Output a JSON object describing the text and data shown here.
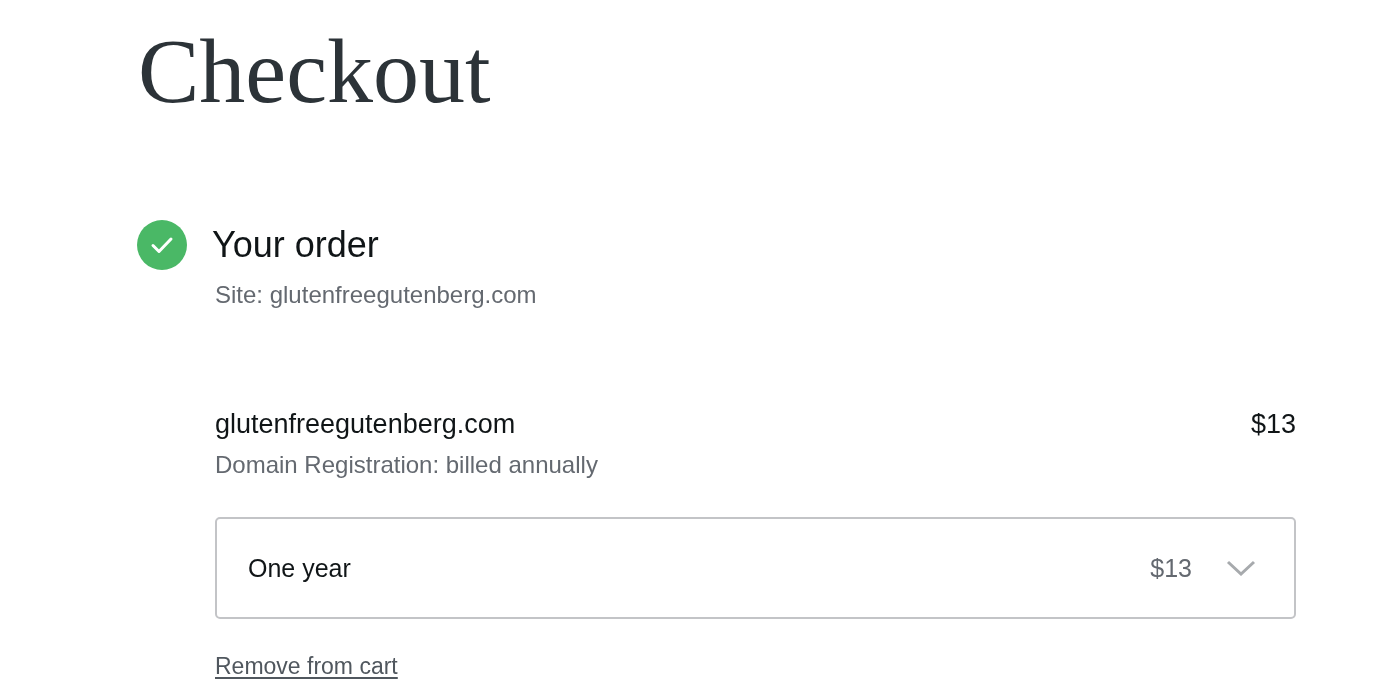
{
  "page": {
    "title": "Checkout"
  },
  "steps": [
    {
      "title": "Your order",
      "complete": true,
      "subtitle": "Site: glutenfreegutenberg.com",
      "items": [
        {
          "name": "glutenfreegutenberg.com",
          "price": "$13",
          "description": "Domain Registration: billed annually",
          "term_select": {
            "value": "One year",
            "price": "$13"
          },
          "remove_link": "Remove from cart"
        }
      ]
    }
  ]
}
